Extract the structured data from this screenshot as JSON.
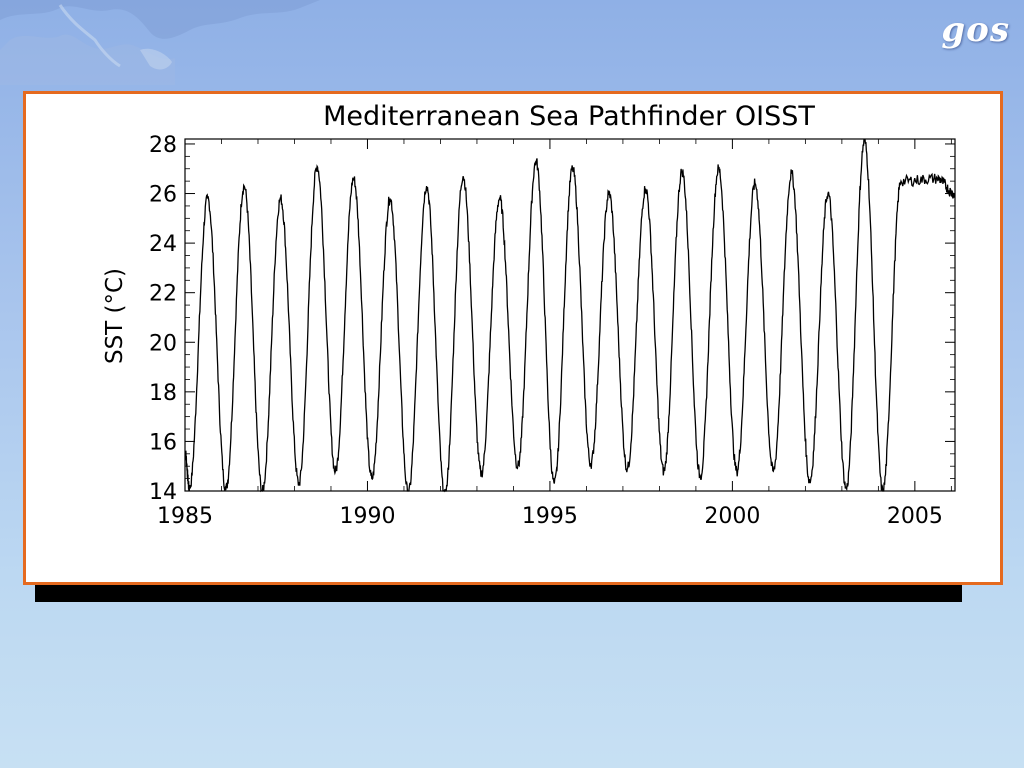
{
  "logo": {
    "text": "gos"
  },
  "colors": {
    "frame_border": "#e56a1f",
    "series_line": "#000000",
    "background_top": "#8fb0e6",
    "background_bottom": "#c7e0f3"
  },
  "chart_data": {
    "type": "line",
    "title": "Mediterranean Sea Pathfinder OISST",
    "xlabel": "",
    "ylabel": "SST (°C)",
    "xlim": [
      1985,
      2006.1
    ],
    "ylim": [
      14,
      28.2
    ],
    "xticks": [
      1985,
      1990,
      1995,
      2000,
      2005
    ],
    "yticks": [
      14,
      16,
      18,
      20,
      22,
      24,
      26,
      28
    ],
    "grid": false,
    "legend": "none",
    "series": [
      {
        "yearly_max": [
          25.8,
          26.3,
          25.8,
          27.1,
          26.6,
          25.8,
          26.3,
          26.7,
          25.8,
          27.3,
          27.0,
          26.0,
          26.2,
          26.9,
          27.0,
          26.4,
          26.8,
          26.0,
          28.1,
          26.5,
          26.6
        ],
        "yearly_min": [
          14.1,
          14.1,
          14.0,
          14.3,
          14.8,
          14.5,
          13.9,
          13.8,
          14.7,
          15.0,
          14.3,
          15.1,
          14.9,
          14.8,
          14.6,
          14.8,
          14.8,
          14.4,
          14.1,
          14.0
        ],
        "max_month_offset": 0.62,
        "min_month_offset": 0.12
      }
    ]
  }
}
